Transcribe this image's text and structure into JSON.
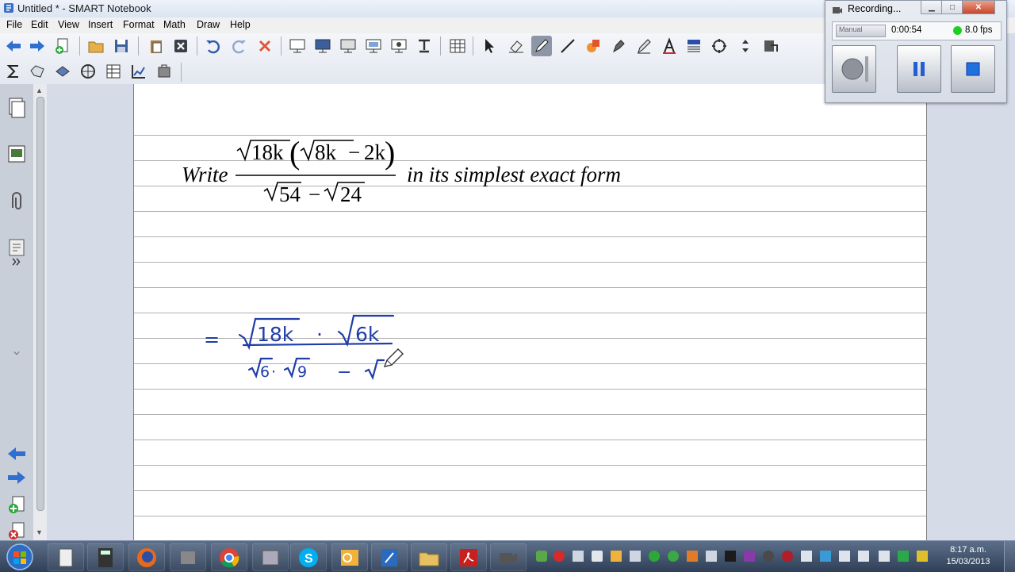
{
  "window": {
    "title": "Untitled * - SMART Notebook"
  },
  "menu": [
    "File",
    "Edit",
    "View",
    "Insert",
    "Format",
    "Math",
    "Draw",
    "Help"
  ],
  "problem": {
    "prefix": "Write",
    "numerator": {
      "radicand1": "18k",
      "radicand2": "8k",
      "minus": "−",
      "term": "2k"
    },
    "denominator": {
      "radicand1": "54",
      "minus": "−",
      "radicand2": "24"
    },
    "suffix": "in its simplest exact  form"
  },
  "handwriting": {
    "equals": "=",
    "num_a": "18k",
    "dot": "·",
    "num_b": "6k",
    "den_a": "6",
    "den_b": "9",
    "den_minus": "−"
  },
  "recorder": {
    "title": "Recording...",
    "mode": "Manual",
    "time": "0:00:54",
    "fps": "8.0 fps",
    "status_color": "#1ed01e"
  },
  "taskbar": {
    "time": "8:17 a.m.",
    "date": "15/03/2013"
  },
  "colors": {
    "ink": "#1f3ea8",
    "accent": "#2a5aa8"
  }
}
